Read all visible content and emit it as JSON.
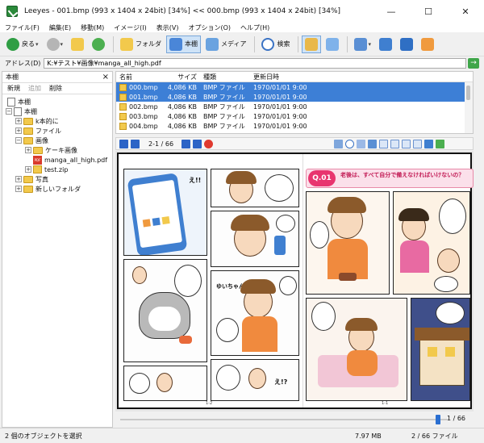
{
  "window": {
    "title": "Leeyes - 001.bmp (993 x 1404 x 24bit) [34%]   <<   000.bmp (993 x 1404 x 24bit) [34%]",
    "minimize": "—",
    "maximize": "☐",
    "close": "✕"
  },
  "menu": [
    "ファイル(F)",
    "編集(E)",
    "移動(M)",
    "イメージ(I)",
    "表示(V)",
    "オプション(O)",
    "ヘルプ(H)"
  ],
  "toolbar": {
    "back": "戻る",
    "folder": "フォルダ",
    "bookshelf": "本棚",
    "media": "メディア",
    "search": "検索"
  },
  "address": {
    "label": "アドレス(D)",
    "value": "K:¥テスト¥画像¥manga_all_high.pdf"
  },
  "sidebar": {
    "title": "本棚",
    "close": "×",
    "actions": [
      "新規",
      "追加",
      "削除"
    ],
    "tree": [
      {
        "label": "本棚",
        "depth": 0,
        "icon": "book",
        "toggle": ""
      },
      {
        "label": "本棚",
        "depth": 0,
        "icon": "book",
        "toggle": "−"
      },
      {
        "label": "k本的に",
        "depth": 1,
        "icon": "folder",
        "toggle": "+"
      },
      {
        "label": "ファイル",
        "depth": 1,
        "icon": "folder",
        "toggle": "+"
      },
      {
        "label": "画像",
        "depth": 1,
        "icon": "folder",
        "toggle": "−"
      },
      {
        "label": "ケーキ画像",
        "depth": 2,
        "icon": "folder",
        "toggle": "+"
      },
      {
        "label": "manga_all_high.pdf",
        "depth": 2,
        "icon": "pdf",
        "toggle": ""
      },
      {
        "label": "test.zip",
        "depth": 2,
        "icon": "zip",
        "toggle": "+"
      },
      {
        "label": "写真",
        "depth": 1,
        "icon": "folder",
        "toggle": "+"
      },
      {
        "label": "新しいフォルダ",
        "depth": 1,
        "icon": "folder",
        "toggle": "+"
      }
    ]
  },
  "filelist": {
    "columns": [
      "名前",
      "サイズ",
      "種類",
      "更新日時"
    ],
    "rows": [
      {
        "name": "000.bmp",
        "size": "4,086 KB",
        "type": "BMP ファイル",
        "date": "1970/01/01 9:00",
        "selected": true
      },
      {
        "name": "001.bmp",
        "size": "4,086 KB",
        "type": "BMP ファイル",
        "date": "1970/01/01 9:00",
        "selected": true
      },
      {
        "name": "002.bmp",
        "size": "4,086 KB",
        "type": "BMP ファイル",
        "date": "1970/01/01 9:00",
        "selected": false
      },
      {
        "name": "003.bmp",
        "size": "4,086 KB",
        "type": "BMP ファイル",
        "date": "1970/01/01 9:00",
        "selected": false
      },
      {
        "name": "004.bmp",
        "size": "4,086 KB",
        "type": "BMP ファイル",
        "date": "1970/01/01 9:00",
        "selected": false
      }
    ]
  },
  "viewer": {
    "page_indicator": "2-1 / 66",
    "q_badge": "Q.01",
    "q_text": "老後は、すべて自分で備えなければいけないの？",
    "shouts": [
      "え!!",
      "ゆいちゃん!!",
      "え!?"
    ],
    "page_left": "1-2",
    "page_right": "1-1"
  },
  "scroll": {
    "page": "1",
    "total": "/ 66",
    "progress": 0.97
  },
  "status": {
    "message": "2 個のオブジェクトを選択",
    "size": "7.97 MB",
    "count": "2 / 66 ファイル"
  },
  "colors": {
    "accent": "#3d7fd6",
    "q_pink": "#e8356f",
    "folder": "#f2c94c"
  }
}
